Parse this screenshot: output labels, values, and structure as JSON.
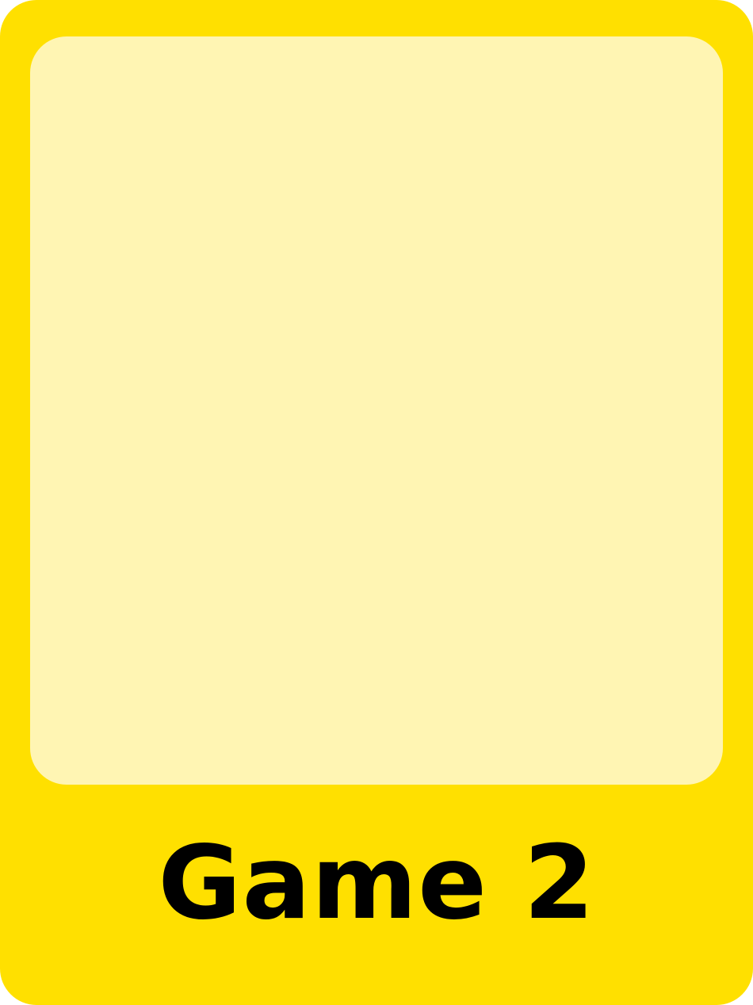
{
  "card": {
    "title": "Game 2",
    "colors": {
      "frame": "#FFE000",
      "image_area": "#FFF5B3",
      "title_text": "#000000"
    }
  }
}
